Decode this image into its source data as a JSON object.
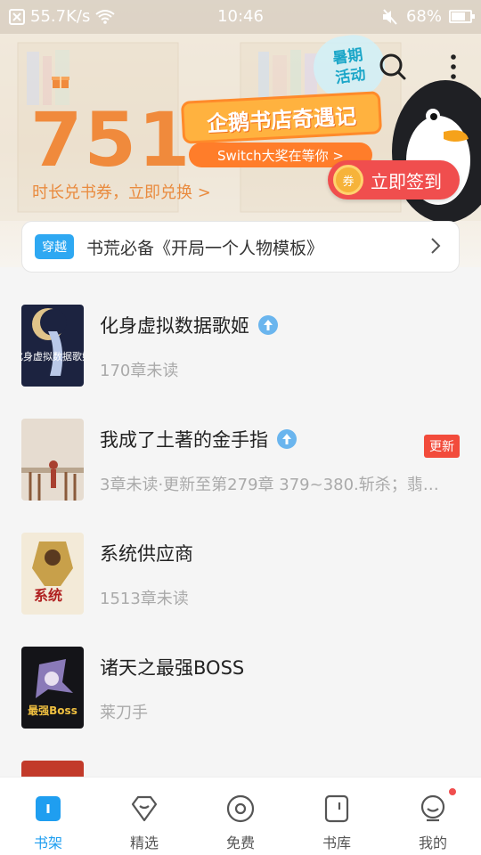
{
  "status_bar": {
    "speed": "55.7K/s",
    "time": "10:46",
    "battery": "68%",
    "battery_level": 0.68
  },
  "header": {
    "promo_bubble_line1": "暑期",
    "promo_bubble_line2": "活动",
    "points": "751",
    "exchange_text": "时长兑书券，立即兑换 >",
    "campaign_title": "企鹅书店奇遇记",
    "campaign_sub": "Switch大奖在等你 >",
    "signin_coin": "券",
    "signin_label": "立即签到"
  },
  "notice": {
    "tag": "穿越",
    "text": "书荒必备《开局一个人物模板》"
  },
  "books": [
    {
      "title": "化身虚拟数据歌姬",
      "sub": "170章未读",
      "badge": "",
      "up_icon": true
    },
    {
      "title": "我成了土著的金手指",
      "sub": "3章未读·更新至第279章 379~380.斩杀；翡…",
      "badge": "更新",
      "up_icon": true
    },
    {
      "title": "系统供应商",
      "sub": "1513章未读",
      "badge": "",
      "up_icon": false
    },
    {
      "title": "诸天之最强BOSS",
      "sub": "莱刀手",
      "badge": "",
      "up_icon": false
    }
  ],
  "cover_texts": {
    "book1": "化身虚拟数据歌姬",
    "book3": "系统",
    "book4": "最强Boss"
  },
  "nav": [
    {
      "label": "书架",
      "icon": "bookshelf-icon",
      "active": true
    },
    {
      "label": "精选",
      "icon": "diamond-icon",
      "active": false
    },
    {
      "label": "免费",
      "icon": "coin-icon",
      "active": false
    },
    {
      "label": "书库",
      "icon": "library-icon",
      "active": false
    },
    {
      "label": "我的",
      "icon": "profile-icon",
      "active": false
    }
  ],
  "colors": {
    "accent": "#1f9ef0",
    "orange": "#f08a3c",
    "signin_red": "#f04e4e",
    "update_badge": "#f24b3b"
  }
}
